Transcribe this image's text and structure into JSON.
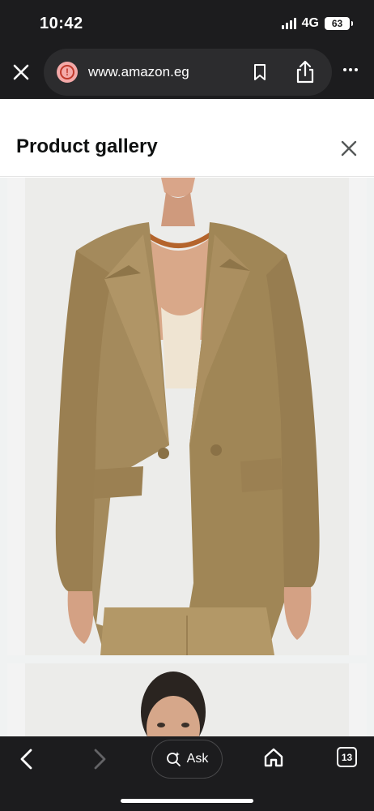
{
  "status": {
    "time": "10:42",
    "network": "4G",
    "battery": "63"
  },
  "browser": {
    "url": "www.amazon.eg",
    "tabs_count": "13"
  },
  "gallery": {
    "title": "Product gallery"
  },
  "toolbar": {
    "ask_label": "Ask"
  },
  "images": [
    {
      "name": "product-image-blazer-front"
    },
    {
      "name": "product-image-model-portrait"
    }
  ],
  "colors": {
    "blazer": "#a48a5c",
    "background": "#f0f2f2",
    "chrome": "#1c1c1e"
  }
}
